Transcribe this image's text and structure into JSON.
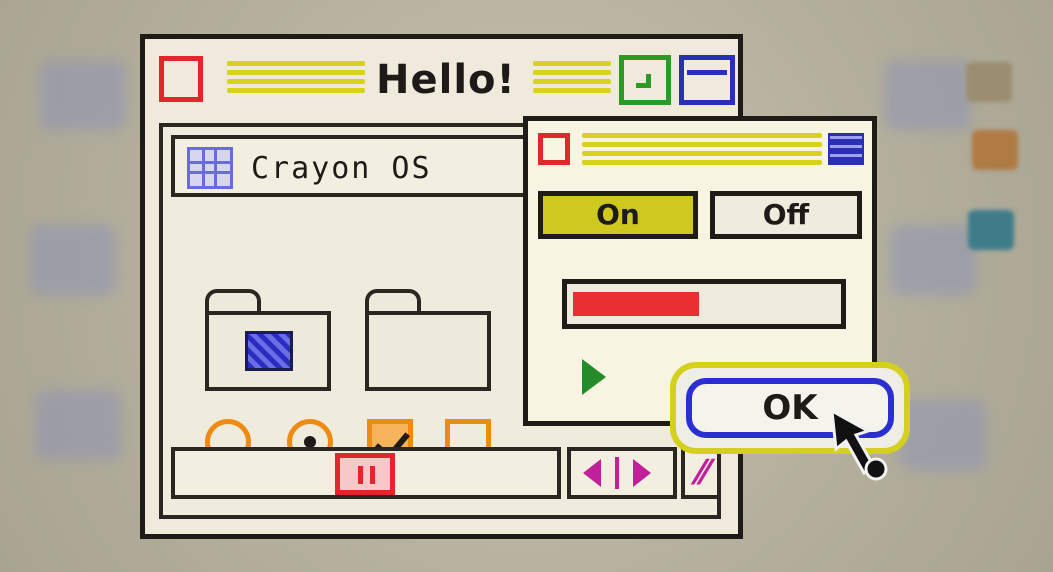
{
  "window": {
    "title": "Hello!"
  },
  "folder_tab": {
    "label": "Crayon OS"
  },
  "dialog": {
    "toggle_on_label": "On",
    "toggle_off_label": "Off",
    "progress": 0.48,
    "ok_label": "OK"
  },
  "icons": {
    "close": "close-icon",
    "minimize": "minimize-icon",
    "maximize": "maximize-icon",
    "grid": "grid-icon",
    "folder": "folder-icon",
    "pause": "pause-icon",
    "arrow_left": "arrow-left-icon",
    "arrow_right": "arrow-right-icon",
    "resize": "resize-icon",
    "play": "play-icon",
    "cursor": "pointer-cursor-icon"
  },
  "colors": {
    "red": "#e2262b",
    "yellow": "#d8d21c",
    "green": "#2c9a24",
    "blue": "#2b2fb3",
    "orange": "#ef8a12",
    "magenta": "#c0209a"
  }
}
